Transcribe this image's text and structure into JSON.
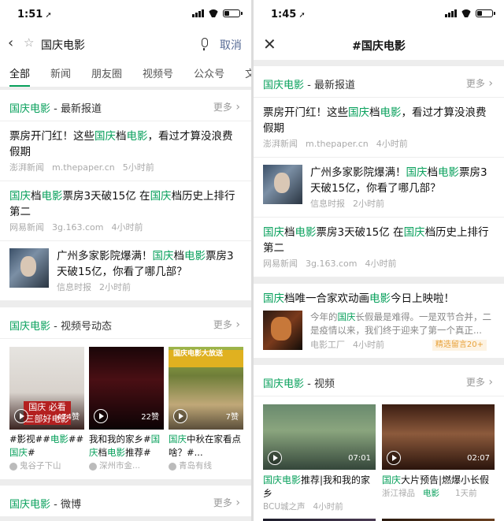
{
  "left": {
    "status": {
      "time": "1:51",
      "loc": "➚"
    },
    "search": {
      "back": "‹",
      "star": "☆",
      "query": "国庆电影",
      "cancel": "取消"
    },
    "tabs": [
      "全部",
      "新闻",
      "朋友圈",
      "视频号",
      "公众号",
      "文章"
    ],
    "latest": {
      "title_hl": "国庆电影",
      "title_rest": " - 最新报道",
      "more": "更多",
      "items": [
        {
          "parts": [
            "票房开门红！这些",
            "国庆",
            "档",
            "电影",
            "，看过才算没浪费假期"
          ],
          "source": "澎湃新闻",
          "domain": "m.thepaper.cn",
          "time": "5小时前"
        },
        {
          "parts": [
            "国庆",
            "档",
            "电影",
            "票房3天破15亿 在",
            "国庆",
            "档历史上排行第二"
          ],
          "source": "网易新闻",
          "domain": "3g.163.com",
          "time": "4小时前"
        },
        {
          "parts": [
            "广州多家影院爆满！",
            "国庆",
            "档",
            "电影",
            "票房3天破15亿，你看了哪几部？"
          ],
          "source": "信息时报",
          "time": "2小时前"
        }
      ]
    },
    "channels": {
      "title_hl": "国庆电影",
      "title_rest": " - 视频号动态",
      "more": "更多",
      "videos": [
        {
          "poster": "国庆 必看 三部好电影",
          "count": "474赞",
          "cap": [
            "#影视##",
            "电影",
            "##",
            "国庆",
            "#"
          ],
          "author": "鬼谷子下山"
        },
        {
          "count": "22赞",
          "cap": [
            "我和我的家乡#",
            "国庆",
            "档",
            "电影",
            "推荐#我..."
          ],
          "author": "深州市金..."
        },
        {
          "ribbon": "国庆电影大放送",
          "count": "7赞",
          "cap": [
            "国庆",
            "中秋在家看点啥？#..."
          ],
          "author": "青岛有线"
        }
      ]
    },
    "weibo": {
      "title_hl": "国庆电影",
      "title_rest": " - 微博",
      "more": "更多"
    }
  },
  "right": {
    "status": {
      "time": "1:45",
      "loc": "➚"
    },
    "header": {
      "close": "✕",
      "title": "#国庆电影"
    },
    "latest": {
      "title_hl": "国庆电影",
      "title_rest": " - 最新报道",
      "more": "更多",
      "items": [
        {
          "parts": [
            "票房开门红！这些",
            "国庆",
            "档",
            "电影",
            "，看过才算没浪费假期"
          ],
          "source": "澎湃新闻",
          "domain": "m.thepaper.cn",
          "time": "4小时前"
        },
        {
          "parts": [
            "广州多家影院爆满！",
            "国庆",
            "档",
            "电影",
            "票房3天破15亿，你看了哪几部？"
          ],
          "source": "信息时报",
          "time": "2小时前"
        },
        {
          "parts": [
            "国庆",
            "档",
            "电影",
            "票房3天破15亿 在",
            "国庆",
            "档历史上排行第二"
          ],
          "source": "网易新闻",
          "domain": "3g.163.com",
          "time": "4小时前"
        }
      ]
    },
    "article": {
      "title": [
        "国庆",
        "档唯一合家欢动画",
        "电影",
        "今日上映啦！"
      ],
      "desc": [
        "今年的",
        "国庆",
        "长假最是难得。一是双节合并，二是疫情以来，我们终于迎来了第一个真正..."
      ],
      "source": "电影工厂",
      "time": "4小时前",
      "tag": "精选留言20+"
    },
    "videos": {
      "title_hl": "国庆电影",
      "title_rest": " - 视频",
      "more": "更多",
      "items": [
        {
          "duration": "07:01",
          "cap": [
            "国庆电影",
            "推荐|我和我的家乡"
          ],
          "source": "BCU城之声",
          "time": "4小时前"
        },
        {
          "duration": "02:07",
          "cap": [
            "国庆",
            "大片预告|燃爆小长假"
          ],
          "source": "浙江禄品",
          "source_hl": "电影",
          "time": "1天前"
        }
      ]
    }
  }
}
